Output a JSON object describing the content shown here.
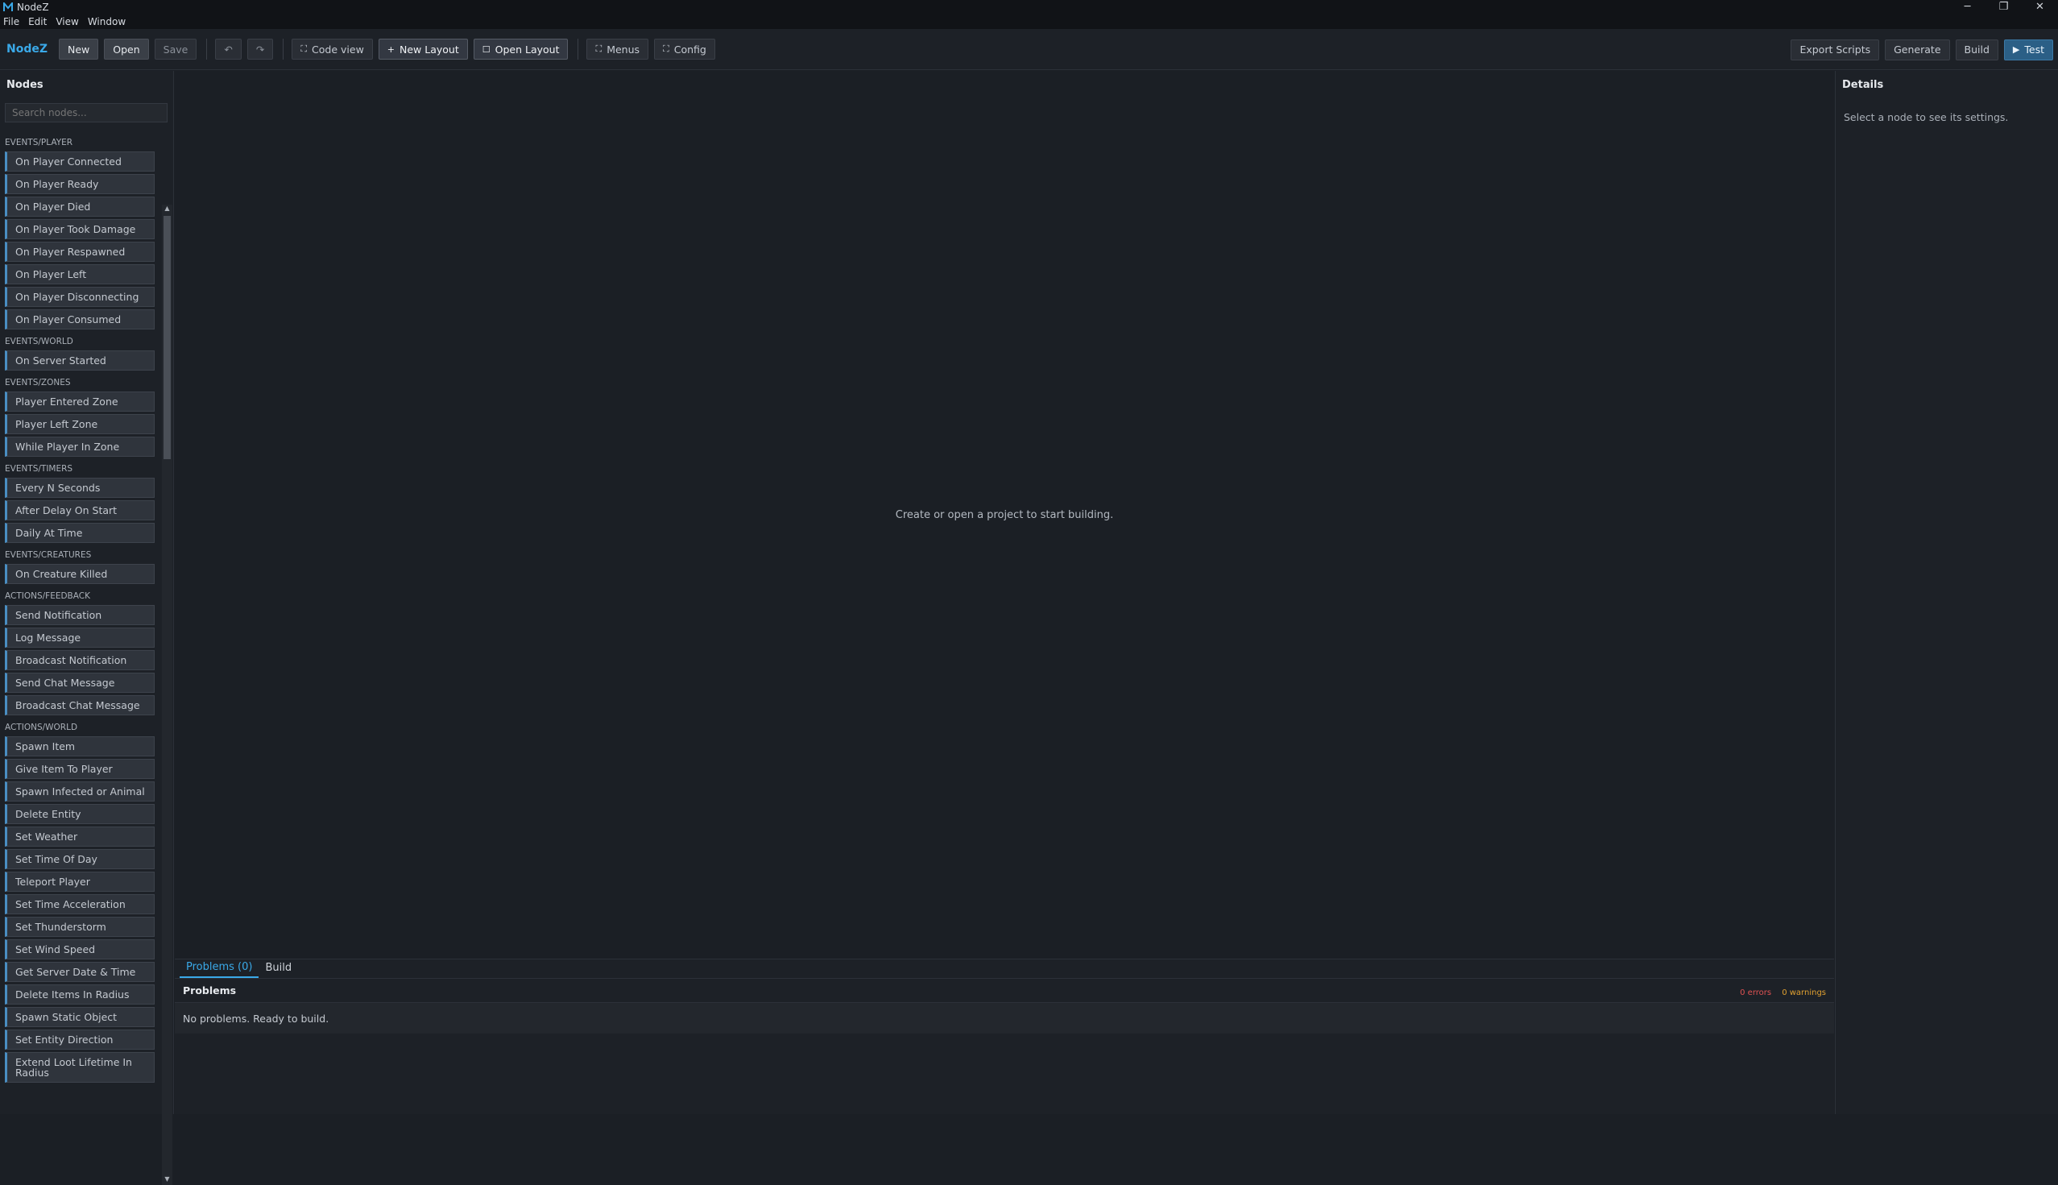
{
  "window": {
    "title": "NodeZ",
    "controls": [
      "─",
      "❐",
      "✕"
    ]
  },
  "menu": [
    "File",
    "Edit",
    "View",
    "Window"
  ],
  "toolbar": {
    "brand": "NodeZ",
    "new": "New",
    "open": "Open",
    "save": "Save",
    "undo": "↶",
    "redo": "↷",
    "code_view": "Code view",
    "new_layout": "New Layout",
    "open_layout": "Open Layout",
    "menus": "Menus",
    "config": "Config",
    "export": "Export Scripts",
    "generate": "Generate",
    "build": "Build",
    "test": "Test"
  },
  "sidebar": {
    "title": "Nodes",
    "search_placeholder": "Search nodes...",
    "categories": [
      {
        "name": "EVENTS/PLAYER",
        "nodes": [
          "On Player Connected",
          "On Player Ready",
          "On Player Died",
          "On Player Took Damage",
          "On Player Respawned",
          "On Player Left",
          "On Player Disconnecting",
          "On Player Consumed"
        ]
      },
      {
        "name": "EVENTS/WORLD",
        "nodes": [
          "On Server Started"
        ]
      },
      {
        "name": "EVENTS/ZONES",
        "nodes": [
          "Player Entered Zone",
          "Player Left Zone",
          "While Player In Zone"
        ]
      },
      {
        "name": "EVENTS/TIMERS",
        "nodes": [
          "Every N Seconds",
          "After Delay On Start",
          "Daily At Time"
        ]
      },
      {
        "name": "EVENTS/CREATURES",
        "nodes": [
          "On Creature Killed"
        ]
      },
      {
        "name": "ACTIONS/FEEDBACK",
        "nodes": [
          "Send Notification",
          "Log Message",
          "Broadcast Notification",
          "Send Chat Message",
          "Broadcast Chat Message"
        ]
      },
      {
        "name": "ACTIONS/WORLD",
        "nodes": [
          "Spawn Item",
          "Give Item To Player",
          "Spawn Infected or Animal",
          "Delete Entity",
          "Set Weather",
          "Set Time Of Day",
          "Teleport Player",
          "Set Time Acceleration",
          "Set Thunderstorm",
          "Set Wind Speed",
          "Get Server Date & Time",
          "Delete Items In Radius",
          "Spawn Static Object",
          "Set Entity Direction",
          "Extend Loot Lifetime In Radius"
        ]
      }
    ]
  },
  "canvas": {
    "empty_message": "Create or open a project to start building."
  },
  "bottom_panel": {
    "tabs": [
      "Problems (0)",
      "Build"
    ],
    "problems_title": "Problems",
    "errors": "0 errors",
    "warnings": "0 warnings",
    "message": "No problems. Ready to build."
  },
  "details": {
    "title": "Details",
    "hint": "Select a node to see its settings."
  },
  "colors": {
    "accent": "#3aa9e8",
    "test_button": "#2b5f86",
    "error": "#e05252",
    "warning": "#e0a030"
  }
}
